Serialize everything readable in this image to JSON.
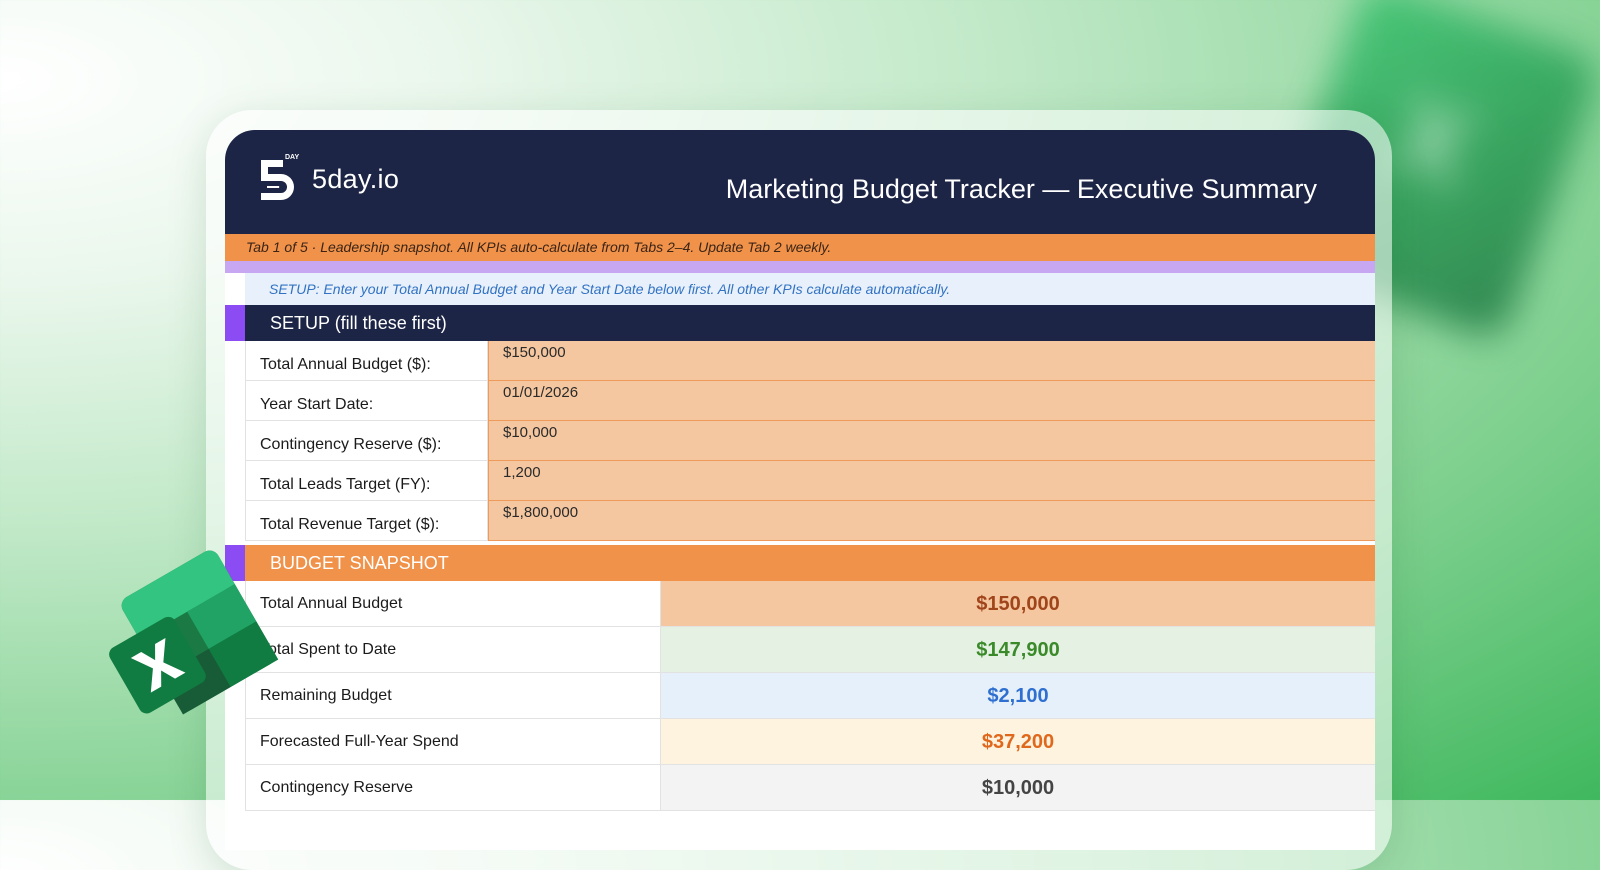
{
  "brand": {
    "name": "5day.io",
    "mark_text": "DAY"
  },
  "header": {
    "title": "Marketing Budget Tracker — Executive Summary"
  },
  "tabbar": {
    "text": "Tab 1 of 5  ·  Leadership snapshot. All KPIs auto-calculate from Tabs 2–4. Update Tab 2 weekly."
  },
  "setup_note": "SETUP: Enter your Total Annual Budget and Year Start Date below first. All other KPIs calculate automatically.",
  "setup": {
    "heading": "SETUP (fill these first)",
    "rows": [
      {
        "label": "Total Annual Budget ($):",
        "value": "$150,000"
      },
      {
        "label": "Year Start Date:",
        "value": "01/01/2026"
      },
      {
        "label": "Contingency Reserve ($):",
        "value": "$10,000"
      },
      {
        "label": "Total Leads Target (FY):",
        "value": "1,200"
      },
      {
        "label": "Total Revenue Target ($):",
        "value": "$1,800,000"
      }
    ]
  },
  "snapshot": {
    "heading": "BUDGET SNAPSHOT",
    "rows": [
      {
        "label": "Total Annual Budget",
        "value": "$150,000",
        "color": "#a0441a",
        "bg": "#f5c7a0"
      },
      {
        "label": "Total Spent to Date",
        "value": "$147,900",
        "color": "#3a8a2a",
        "bg": "#e5f2e3"
      },
      {
        "label": "Remaining Budget",
        "value": "$2,100",
        "color": "#2f6fcf",
        "bg": "#e6f0fb"
      },
      {
        "label": "Forecasted Full-Year Spend",
        "value": "$37,200",
        "color": "#e0681c",
        "bg": "#fdf3df"
      },
      {
        "label": "Contingency Reserve",
        "value": "$10,000",
        "color": "#444444",
        "bg": "#f3f3f3"
      }
    ]
  },
  "colors": {
    "navy": "#1d2546",
    "orange": "#f0924a",
    "purple": "#8c4cf3",
    "excel_green": "#1f8a4c"
  },
  "icons": {
    "logo": "5day-logo-icon",
    "excel": "excel-icon"
  }
}
